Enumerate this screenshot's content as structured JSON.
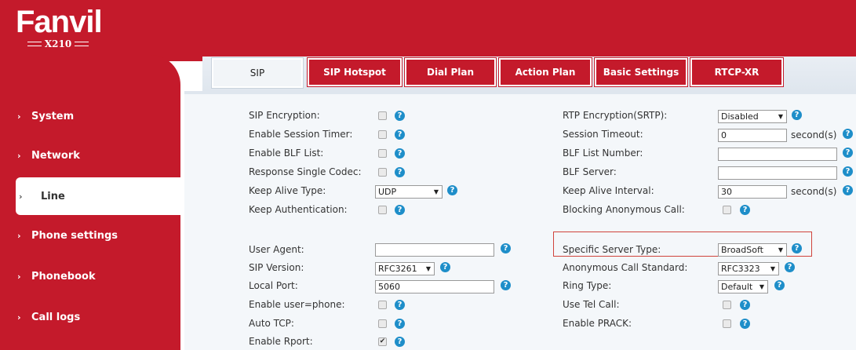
{
  "logo": {
    "brand": "Fanvil",
    "model": "X210"
  },
  "sidebar": {
    "items": [
      {
        "label": "System"
      },
      {
        "label": "Network"
      },
      {
        "label": "Line"
      },
      {
        "label": "Phone settings"
      },
      {
        "label": "Phonebook"
      },
      {
        "label": "Call logs"
      }
    ],
    "active": "Line"
  },
  "tabs": [
    {
      "label": "SIP"
    },
    {
      "label": "SIP Hotspot"
    },
    {
      "label": "Dial Plan"
    },
    {
      "label": "Action Plan"
    },
    {
      "label": "Basic Settings"
    },
    {
      "label": "RTCP-XR"
    }
  ],
  "left": {
    "sip_encryption": {
      "label": "SIP Encryption:",
      "checked": false
    },
    "session_timer": {
      "label": "Enable Session Timer:",
      "checked": false
    },
    "blf_list": {
      "label": "Enable BLF List:",
      "checked": false
    },
    "single_codec": {
      "label": "Response Single Codec:",
      "checked": false
    },
    "keep_alive_type": {
      "label": "Keep Alive Type:",
      "value": "UDP"
    },
    "keep_auth": {
      "label": "Keep Authentication:",
      "checked": false
    },
    "user_agent": {
      "label": "User Agent:",
      "value": ""
    },
    "sip_version": {
      "label": "SIP Version:",
      "value": "RFC3261"
    },
    "local_port": {
      "label": "Local Port:",
      "value": "5060"
    },
    "user_phone": {
      "label": "Enable user=phone:",
      "checked": false
    },
    "auto_tcp": {
      "label": "Auto TCP:",
      "checked": false
    },
    "rport": {
      "label": "Enable Rport:",
      "checked": true
    }
  },
  "right": {
    "rtp_encryption": {
      "label": "RTP Encryption(SRTP):",
      "value": "Disabled"
    },
    "session_timeout": {
      "label": "Session Timeout:",
      "value": "0",
      "unit": "second(s)"
    },
    "blf_number": {
      "label": "BLF List Number:",
      "value": ""
    },
    "blf_server": {
      "label": "BLF Server:",
      "value": ""
    },
    "keep_alive_interval": {
      "label": "Keep Alive Interval:",
      "value": "30",
      "unit": "second(s)"
    },
    "blocking_anon": {
      "label": "Blocking Anonymous Call:",
      "checked": false
    },
    "server_type": {
      "label": "Specific Server Type:",
      "value": "BroadSoft"
    },
    "anon_standard": {
      "label": "Anonymous Call Standard:",
      "value": "RFC3323"
    },
    "ring_type": {
      "label": "Ring Type:",
      "value": "Default"
    },
    "tel_call": {
      "label": "Use Tel Call:",
      "checked": false
    },
    "prack": {
      "label": "Enable PRACK:",
      "checked": false
    }
  },
  "colors": {
    "brand_red": "#c41a2b",
    "help_blue": "#1e8ec9",
    "highlight": "#d0433b"
  },
  "icons": {
    "help": "question-circle-icon",
    "dropdown": "chevron-down-icon"
  }
}
